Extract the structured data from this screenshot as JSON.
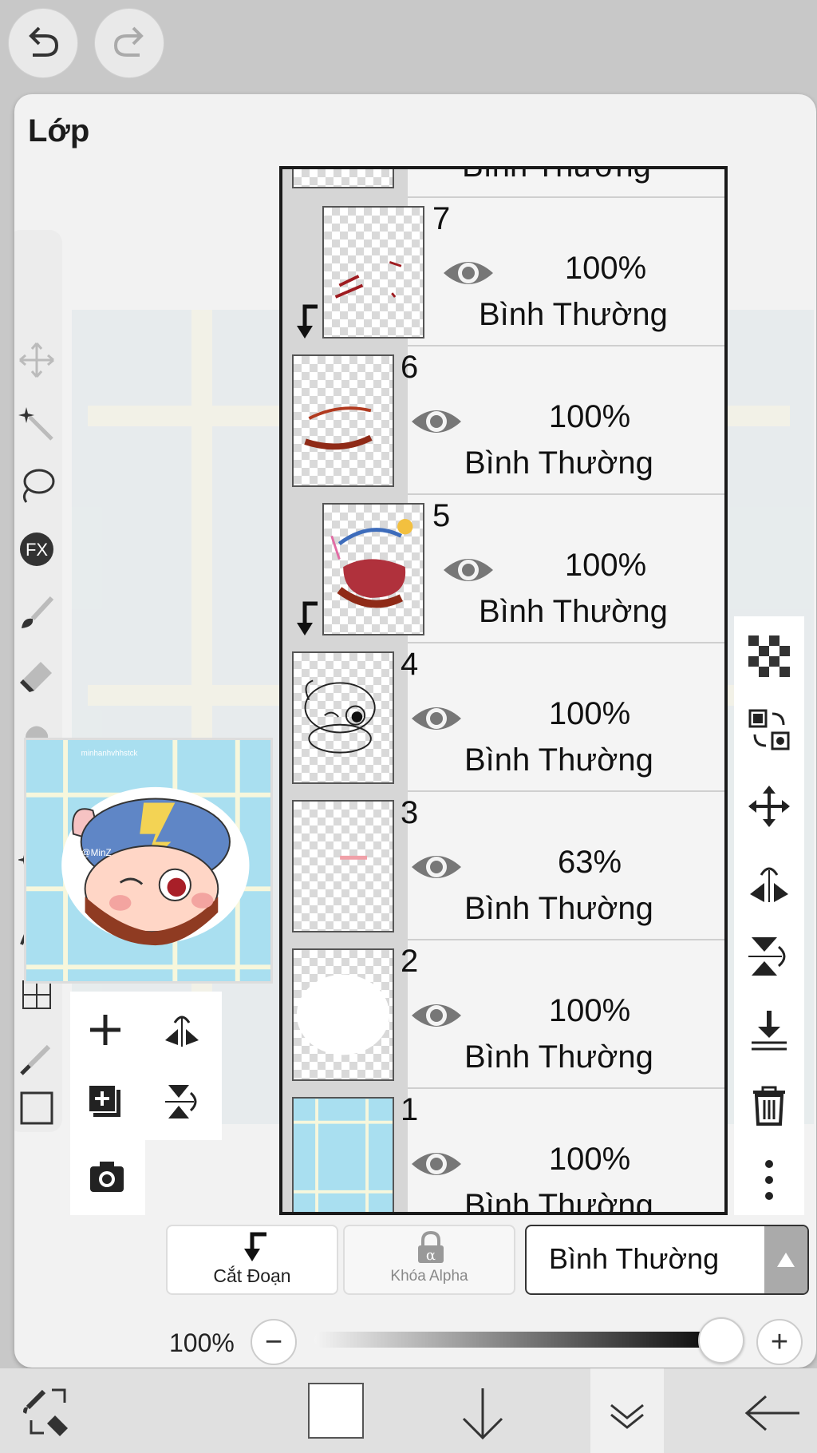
{
  "panel": {
    "title": "Lớp"
  },
  "top_buttons": {
    "undo_icon": "undo-icon",
    "redo_icon": "redo-icon"
  },
  "layers": [
    {
      "number": "",
      "opacity": "",
      "blend": "Bình Thường",
      "clipped": false
    },
    {
      "number": "7",
      "opacity": "100%",
      "blend": "Bình Thường",
      "clipped": true
    },
    {
      "number": "6",
      "opacity": "100%",
      "blend": "Bình Thường",
      "clipped": false
    },
    {
      "number": "5",
      "opacity": "100%",
      "blend": "Bình Thường",
      "clipped": true
    },
    {
      "number": "4",
      "opacity": "100%",
      "blend": "Bình Thường",
      "clipped": false
    },
    {
      "number": "3",
      "opacity": "63%",
      "blend": "Bình Thường",
      "clipped": false
    },
    {
      "number": "2",
      "opacity": "100%",
      "blend": "Bình Thường",
      "clipped": false
    },
    {
      "number": "1",
      "opacity": "100%",
      "blend": "Bình Thường",
      "clipped": false
    }
  ],
  "bottom": {
    "clip_label": "Cắt Đoạn",
    "alpha_lock_label": "Khóa Alpha",
    "blend_mode": "Bình Thường",
    "opacity_label": "100%",
    "opacity_value": 1.0,
    "minus": "−",
    "plus": "+"
  },
  "right_toolbar": [
    "checker-icon",
    "transform-layer-icon",
    "move-icon",
    "flip-horizontal-icon",
    "flip-vertical-icon",
    "merge-down-icon",
    "trash-icon",
    "more-icon"
  ],
  "colors": {
    "panel_bg": "#f2f2f2",
    "list_border": "#1a1a1a",
    "slider_end": "#000000"
  }
}
